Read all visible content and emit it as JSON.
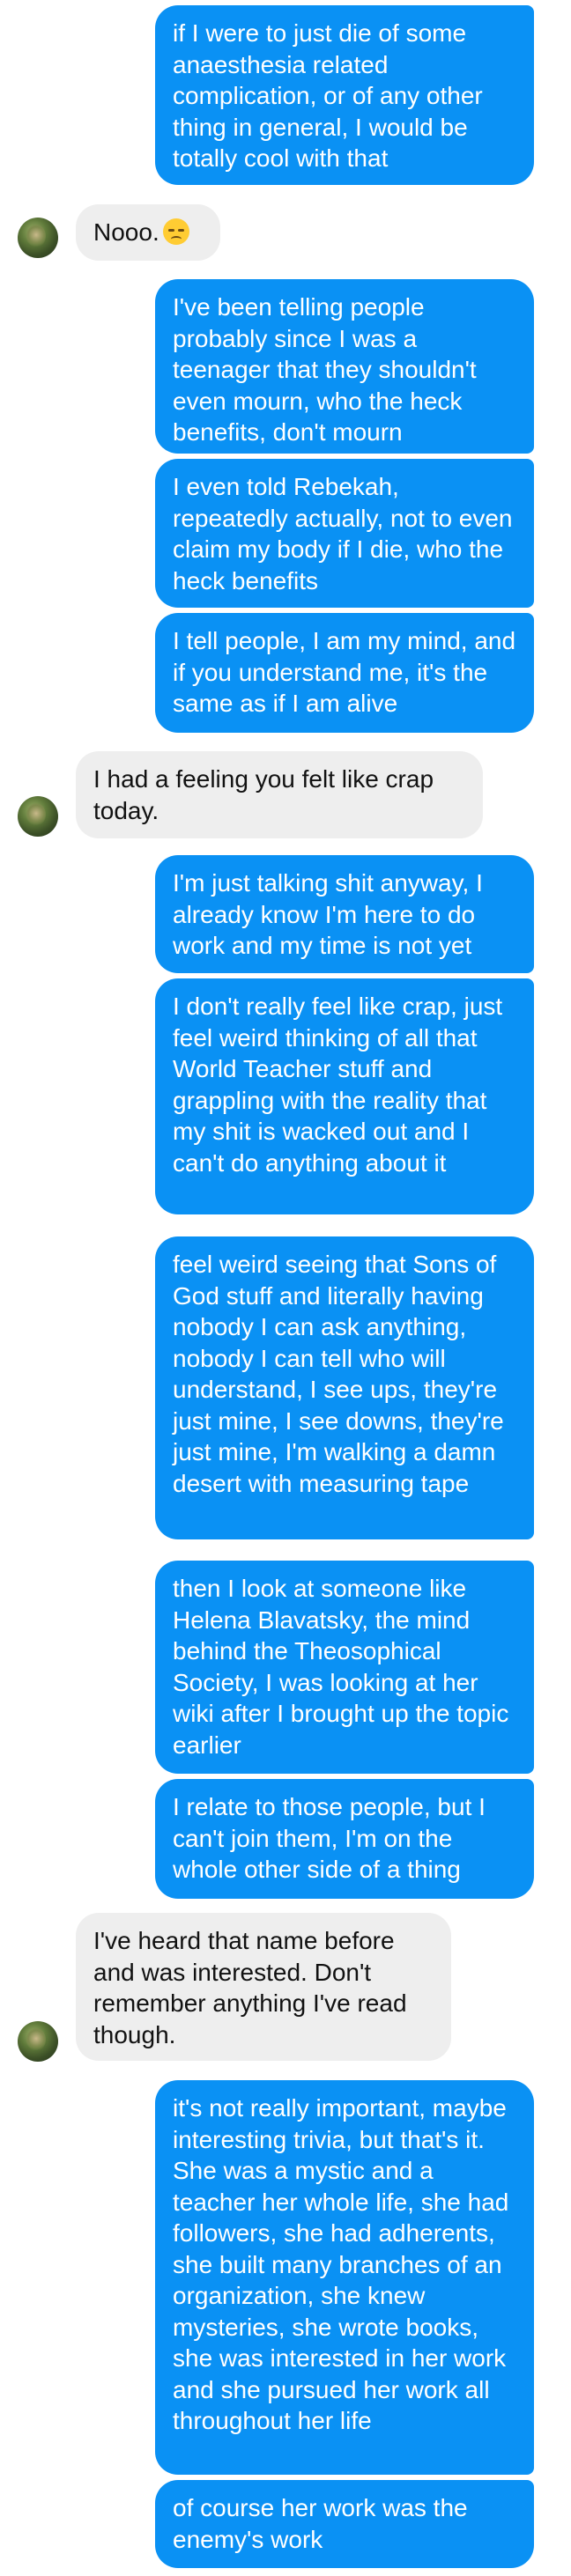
{
  "messages": [
    {
      "id": "m1",
      "side": "sent",
      "text": "if I were to just die of some anaesthesia related complication, or of any other thing in general, I would be totally cool with that"
    },
    {
      "id": "m2",
      "side": "received",
      "text": "Nooo."
    },
    {
      "id": "m3",
      "side": "sent",
      "text": "I've been telling people probably since I was a teenager that they shouldn't even mourn, who the heck benefits, don't mourn"
    },
    {
      "id": "m4",
      "side": "sent",
      "text": "I even told Rebekah, repeatedly actually, not to even claim my body if I die, who the heck benefits"
    },
    {
      "id": "m5",
      "side": "sent",
      "text": "I tell people, I am my mind, and if you understand me, it's the same as if I am alive"
    },
    {
      "id": "m6",
      "side": "received",
      "text": "I had a feeling you felt like crap today."
    },
    {
      "id": "m7",
      "side": "sent",
      "text": "I'm just talking shit anyway, I already know I'm here to do work and my time is not yet"
    },
    {
      "id": "m8",
      "side": "sent",
      "text": "I don't really feel like crap, just feel weird thinking of all that World Teacher stuff and grappling with the reality that my shit is wacked out and I can't do anything about it"
    },
    {
      "id": "m9",
      "side": "sent",
      "text": "feel weird seeing that Sons of God stuff and literally having nobody I can ask anything, nobody I can tell who will understand, I see ups, they're just mine, I see downs, they're just mine, I'm walking a damn desert with measuring tape"
    },
    {
      "id": "m10",
      "side": "sent",
      "text": "then I look at someone like Helena Blavatsky, the mind behind the Theosophical Society, I was looking at her wiki after I brought up the topic earlier"
    },
    {
      "id": "m11",
      "side": "sent",
      "text": "I relate to those people, but I can't join them, I'm on the whole other side of a thing"
    },
    {
      "id": "m12",
      "side": "received",
      "text": "I've heard that name before and was interested. Don't remember anything I've read though."
    },
    {
      "id": "m13",
      "side": "sent",
      "text": "it's not really important, maybe interesting trivia, but that's it. She was a mystic and a teacher her whole life, she had followers, she had adherents, she built many branches of an organization, she knew mysteries, she wrote books, she was interested in her work and she pursued her work all throughout her life"
    },
    {
      "id": "m14",
      "side": "sent",
      "text": "of course her work was the enemy's work"
    }
  ],
  "icons": {
    "disappointed_emoji": "disappointed-face-icon",
    "contact_avatar": "contact-avatar"
  },
  "colors": {
    "sent_bubble": "#0a91f4",
    "received_bubble": "#eeeeee",
    "sent_text": "#ffffff",
    "received_text": "#111111"
  }
}
